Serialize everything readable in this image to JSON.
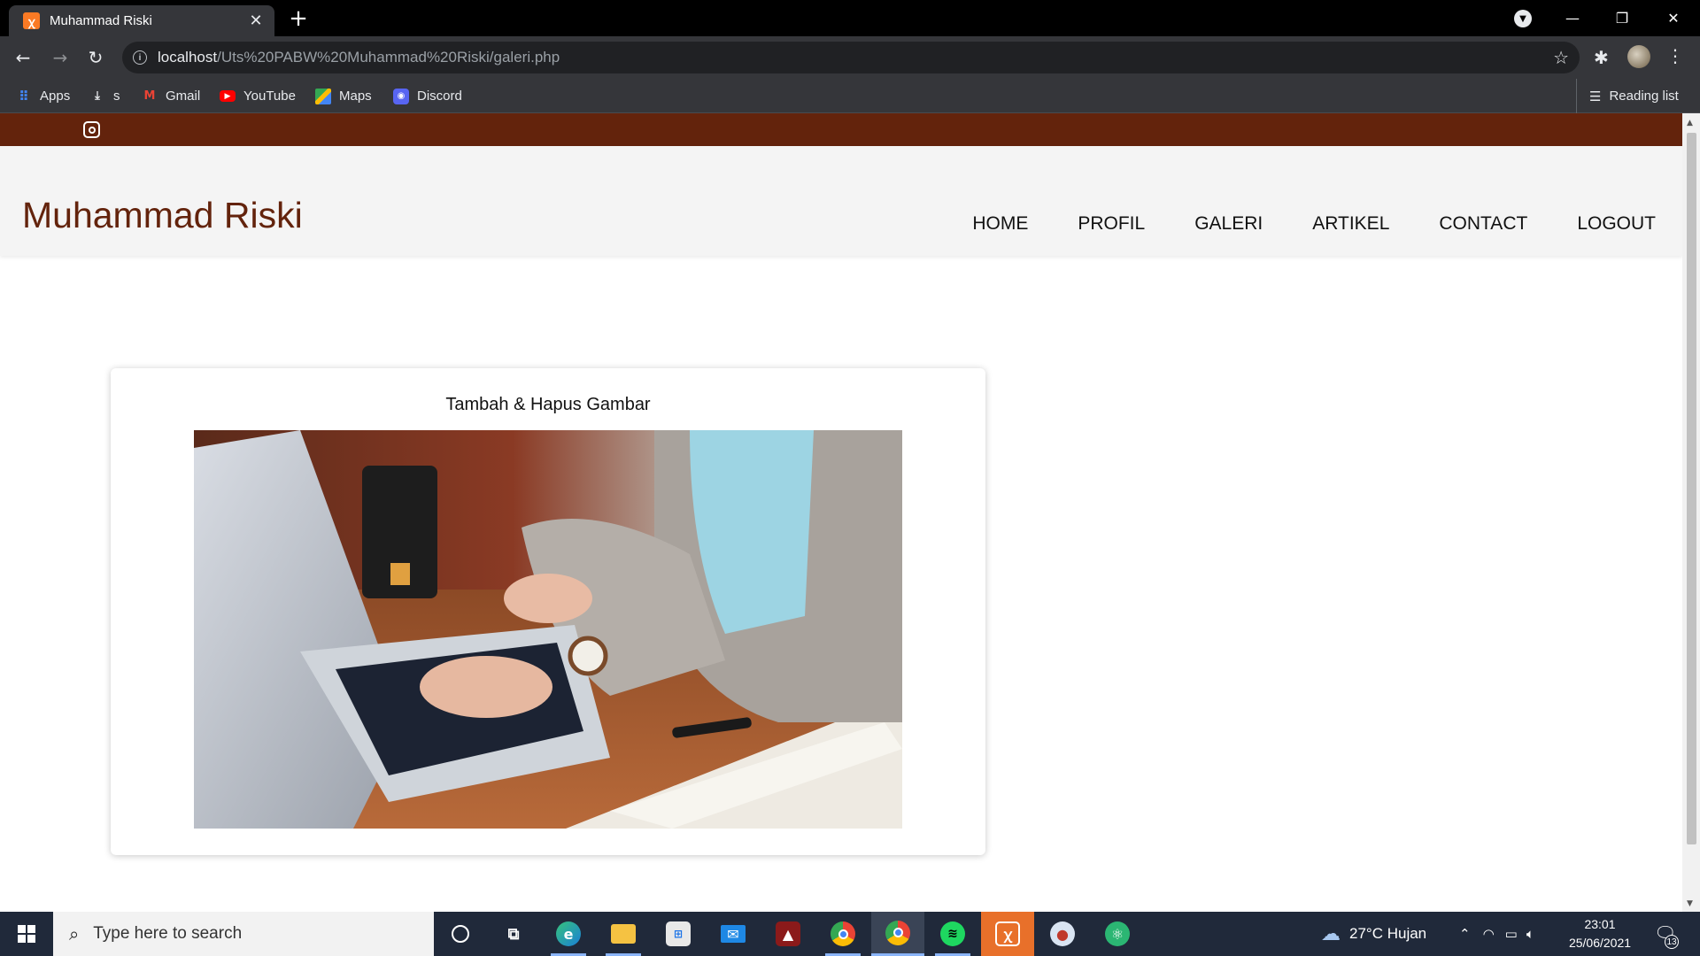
{
  "browser": {
    "tab_title": "Muhammad Riski",
    "tab_favicon": "xampp-icon",
    "url_host": "localhost",
    "url_path": "/Uts%20PABW%20Muhammad%20Riski/galeri.php",
    "bookmarks": [
      {
        "label": "Apps",
        "icon": "apps-grid-icon",
        "color": "#ea4335"
      },
      {
        "label": "s",
        "icon": "download-icon",
        "color": "#e8eaed"
      },
      {
        "label": "Gmail",
        "icon": "gmail-icon",
        "color": "#ea4335"
      },
      {
        "label": "YouTube",
        "icon": "youtube-icon",
        "color": "#ff0000"
      },
      {
        "label": "Maps",
        "icon": "maps-icon",
        "color": "#34a853"
      },
      {
        "label": "Discord",
        "icon": "discord-icon",
        "color": "#5865f2"
      }
    ],
    "reading_list": "Reading list"
  },
  "site": {
    "brand": "Muhammad Riski",
    "accent_color": "#63230c",
    "nav": [
      "HOME",
      "PROFIL",
      "GALERI",
      "ARTIKEL",
      "CONTACT",
      "LOGOUT"
    ],
    "card_title": "Tambah & Hapus Gambar"
  },
  "taskbar": {
    "search_placeholder": "Type here to search",
    "weather": "27°C  Hujan",
    "time": "23:01",
    "date": "25/06/2021",
    "notification_count": "13"
  }
}
